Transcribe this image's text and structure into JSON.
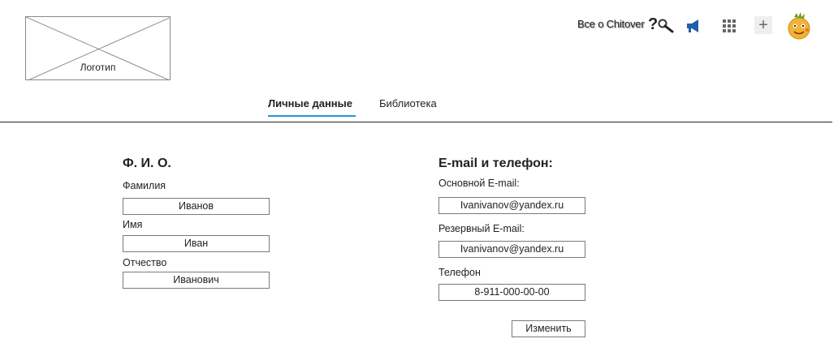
{
  "header": {
    "logo_label": "Логотип",
    "about_link": "Все о Chitover",
    "icons": [
      "help-search-icon",
      "megaphone-icon",
      "apps-grid-icon",
      "plus-icon",
      "avatar"
    ]
  },
  "tabs": [
    {
      "label": "Личные данные",
      "active": true
    },
    {
      "label": "Библиотека",
      "active": false
    }
  ],
  "name_section": {
    "title": "Ф. И. О.",
    "fields": [
      {
        "label": "Фамилия",
        "value": "Иванов"
      },
      {
        "label": "Имя",
        "value": "Иван"
      },
      {
        "label": "Отчество",
        "value": "Иванович"
      }
    ]
  },
  "contact_section": {
    "title": "E-mail и телефон:",
    "fields": [
      {
        "label": "Основной E-mail:",
        "value": "Ivanivanov@yandex.ru"
      },
      {
        "label": "Резервный E-mail:",
        "value": "Ivanivanov@yandex.ru"
      },
      {
        "label": "Телефон",
        "value": "8-911-000-00-00"
      }
    ]
  },
  "actions": {
    "change_label": "Изменить"
  },
  "colors": {
    "tab_underline": "#2a93c9",
    "megaphone": "#1f5fa8",
    "avatar": "#f2b233"
  }
}
